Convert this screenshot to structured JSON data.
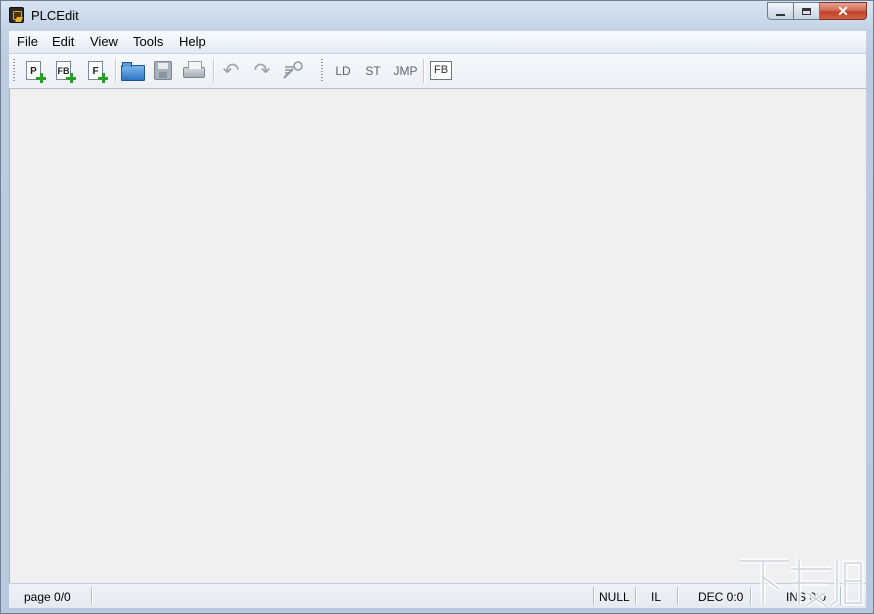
{
  "window": {
    "title": "PLCEdit",
    "caption": {
      "minimize": "–",
      "maximize": "□",
      "close": "✕"
    }
  },
  "menu": {
    "items": [
      "File",
      "Edit",
      "View",
      "Tools",
      "Help"
    ]
  },
  "toolbar": {
    "new_program": "P",
    "new_function_block": "FB",
    "new_function": "F",
    "ld": "LD",
    "st": "ST",
    "jmp": "JMP",
    "fb": "FB",
    "icons": [
      "new-program-icon",
      "new-function-block-icon",
      "new-function-icon",
      "open-folder-icon",
      "save-icon",
      "print-icon",
      "undo-icon",
      "redo-icon",
      "comment-icon"
    ]
  },
  "status": {
    "page": "page 0/0",
    "null": "NULL",
    "lang": "IL",
    "dec": "DEC 0:0",
    "ins": "INS 0:0"
  },
  "colors": {
    "frame": "#c4d3e6",
    "client": "#f0f0f0",
    "close_button": "#c0432a",
    "plus_green": "#28a028",
    "folder_blue": "#2d74c4"
  }
}
